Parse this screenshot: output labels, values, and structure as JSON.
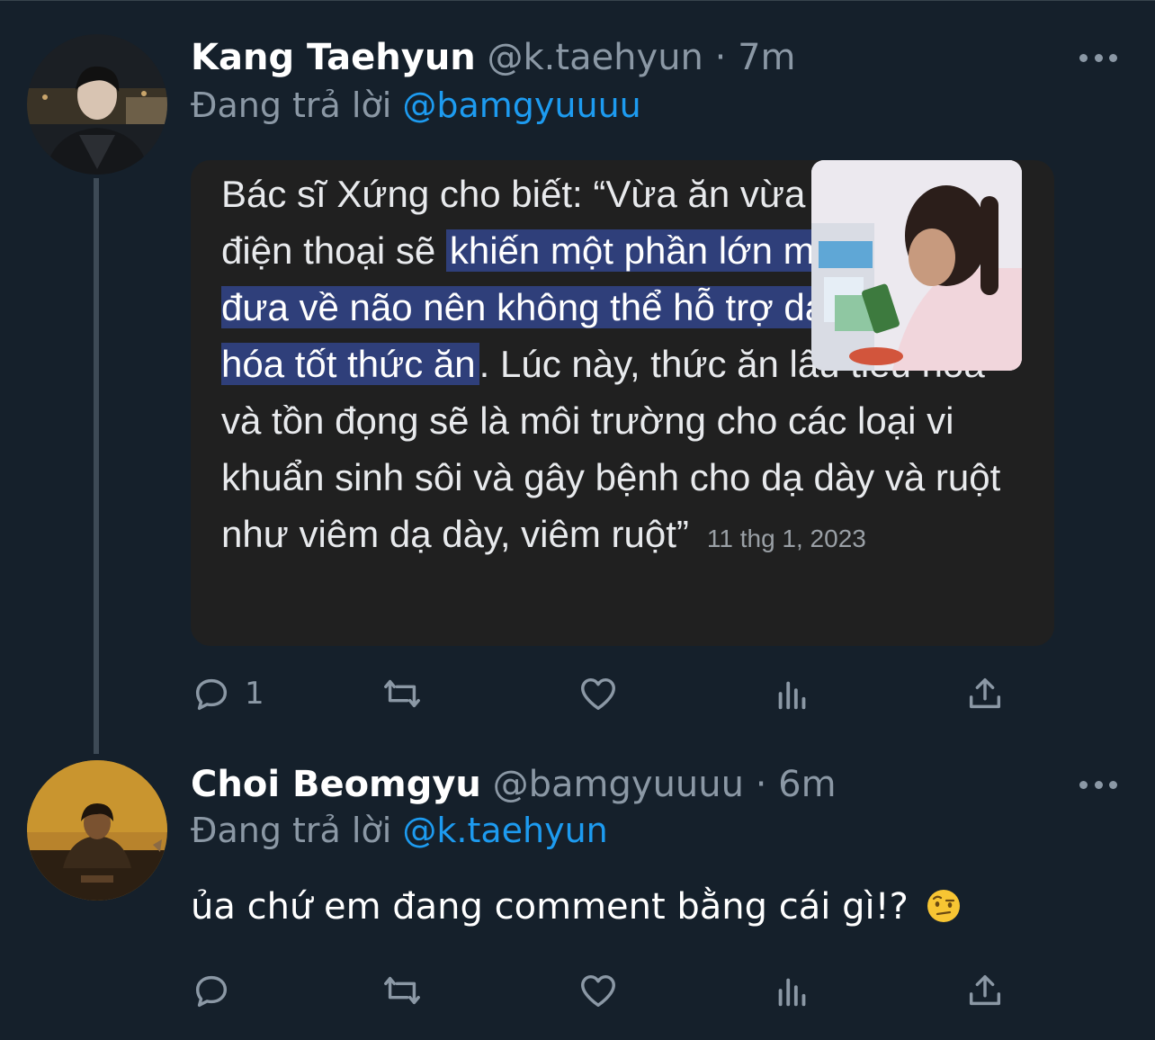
{
  "tweets": [
    {
      "name": "Kang Taehyun",
      "handle": "@k.taehyun",
      "separator": "·",
      "time": "7m",
      "replying_prefix": "Đang trả lời",
      "replying_to": "@bamgyuuuu",
      "quote": {
        "text_1": "Bác sĩ Xứng cho biết: “Vừa ăn vừa sử dụng điện thoại sẽ ",
        "highlight": "khiến một phần lớn máu được đưa về não nên không thể hỗ trợ dạ dày tiêu hóa tốt thức ăn",
        "text_2": ". Lúc này, thức ăn lâu tiêu hóa và tồn đọng sẽ là môi trường cho các loại vi khuẩn sinh sôi và gây bệnh cho dạ dày và ruột như viêm dạ dày, viêm ruột”",
        "date": "11 thg 1, 2023"
      },
      "actions": {
        "reply_count": "1"
      }
    },
    {
      "name": "Choi Beomgyu",
      "handle": "@bamgyuuuu",
      "separator": "·",
      "time": "6m",
      "replying_prefix": "Đang trả lời",
      "replying_to": "@k.taehyun",
      "body": "ủa chứ em đang comment bằng cái gì!?",
      "emoji": "face-with-raised-eyebrow-icon"
    }
  ],
  "colors": {
    "background": "#15202b",
    "accent": "#1d9bf0",
    "secondary_text": "#8b98a5",
    "highlight": "#2f3f7a"
  }
}
